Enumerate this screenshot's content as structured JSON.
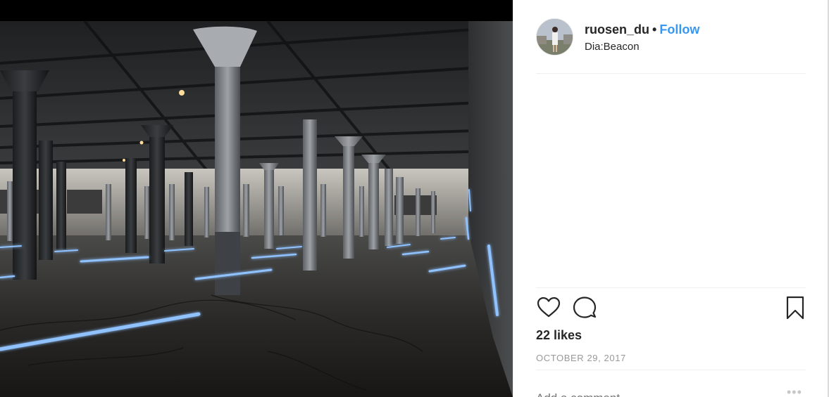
{
  "post": {
    "username": "ruosen_du",
    "separator": "•",
    "follow_label": "Follow",
    "location": "Dia:Beacon",
    "likes": "22 likes",
    "date": "OCTOBER 29, 2017",
    "comment_placeholder": "Add a comment…",
    "more_label": "•••"
  },
  "icons": {
    "like": "heart-icon",
    "comment": "comment-icon",
    "save": "bookmark-icon",
    "more": "more-options-icon"
  },
  "colors": {
    "follow_blue": "#3897f0",
    "text_primary": "#262626",
    "text_secondary": "#999999",
    "neon_blue": "#6fb0ff"
  }
}
